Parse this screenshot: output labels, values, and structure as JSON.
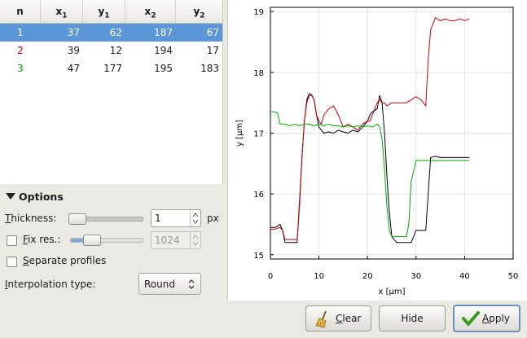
{
  "table": {
    "headers": [
      "n",
      "x",
      "y",
      "x",
      "y"
    ],
    "header_subs": [
      "",
      "1",
      "1",
      "2",
      "2"
    ],
    "rows": [
      {
        "n": "1",
        "x1": "37",
        "y1": "62",
        "x2": "187",
        "y2": "67",
        "color": "#ffffff"
      },
      {
        "n": "2",
        "x1": "39",
        "y1": "12",
        "x2": "194",
        "y2": "17",
        "color": "#cc0000"
      },
      {
        "n": "3",
        "x1": "47",
        "y1": "177",
        "x2": "195",
        "y2": "183",
        "color": "#00a000"
      }
    ]
  },
  "options": {
    "title": "Options",
    "thickness_label": "Thickness:",
    "thickness_value": "1",
    "thickness_unit": "px",
    "thickness_slider_level": 0.0,
    "fixres_label": "Fix res.:",
    "fixres_value": "1024",
    "fixres_checked": false,
    "fixres_slider_level": 0.1,
    "separate_label": "Separate profiles",
    "separate_checked": false,
    "interp_label": "Interpolation type:",
    "interp_value": "Round"
  },
  "buttons": {
    "clear": "Clear",
    "hide": "Hide",
    "apply": "Apply"
  },
  "chart_data": {
    "type": "line",
    "xlabel": "x [µm]",
    "ylabel": "y [µm]",
    "xlim": [
      0,
      50
    ],
    "ylim": [
      14.93,
      19.07
    ],
    "xticks": [
      "0",
      "10",
      "20",
      "30",
      "40",
      "50"
    ],
    "yticks": [
      "15",
      "16",
      "17",
      "18",
      "19"
    ],
    "grid": true,
    "series": [
      {
        "color": "#000000",
        "x": [
          0,
          1,
          2,
          2.5,
          3,
          4,
          5,
          5.5,
          6,
          6.5,
          7,
          7.5,
          8,
          8.5,
          9,
          9.5,
          10,
          10.5,
          11,
          12,
          13,
          14,
          15,
          16,
          17,
          18,
          19,
          20,
          20.5,
          21,
          22,
          22.5,
          23,
          23.5,
          24,
          24.5,
          25,
          26,
          27,
          28,
          29,
          30,
          31,
          32,
          32.5,
          33,
          34,
          35,
          36,
          37,
          38,
          39,
          40,
          41
        ],
        "y": [
          15.45,
          15.45,
          15.5,
          15.4,
          15.2,
          15.2,
          15.2,
          15.2,
          15.9,
          16.6,
          17.2,
          17.55,
          17.65,
          17.63,
          17.55,
          17.3,
          17.1,
          17.05,
          17.0,
          17.02,
          17.0,
          17.05,
          17.02,
          17.0,
          17.05,
          17.02,
          17.1,
          17.2,
          17.3,
          17.35,
          17.4,
          17.62,
          17.5,
          17.0,
          16.3,
          15.7,
          15.3,
          15.2,
          15.2,
          15.2,
          15.2,
          15.4,
          15.4,
          15.4,
          16.0,
          16.6,
          16.62,
          16.6,
          16.6,
          16.6,
          16.6,
          16.6,
          16.6,
          16.6
        ]
      },
      {
        "color": "#cc0000",
        "x": [
          0,
          1,
          2,
          2.5,
          3,
          4,
          5,
          5.5,
          6,
          6.5,
          7,
          7.5,
          8,
          8.5,
          9,
          9.5,
          10,
          10.5,
          11,
          12,
          13,
          14,
          15,
          16,
          17,
          18,
          19,
          20,
          20.5,
          21,
          22,
          22.5,
          23,
          23.5,
          24,
          25,
          26,
          27,
          28,
          29,
          30,
          31,
          31.5,
          32,
          32.5,
          33,
          34,
          35,
          36,
          37,
          38,
          39,
          40,
          41
        ],
        "y": [
          15.42,
          15.42,
          15.45,
          15.4,
          15.25,
          15.25,
          15.25,
          15.25,
          15.8,
          16.6,
          17.2,
          17.5,
          17.62,
          17.62,
          17.55,
          17.3,
          17.2,
          17.15,
          17.3,
          17.4,
          17.45,
          17.3,
          17.1,
          17.15,
          17.1,
          17.05,
          17.15,
          17.2,
          17.2,
          17.3,
          17.5,
          17.55,
          17.5,
          17.5,
          17.45,
          17.5,
          17.5,
          17.5,
          17.5,
          17.55,
          17.6,
          17.55,
          17.5,
          17.45,
          18.2,
          18.7,
          18.9,
          18.85,
          18.88,
          18.85,
          18.85,
          18.88,
          18.85,
          18.88
        ]
      },
      {
        "color": "#00aa00",
        "x": [
          0,
          1,
          1.5,
          2,
          3,
          4,
          5,
          6,
          7,
          8,
          9,
          10,
          11,
          12,
          13,
          14,
          15,
          16,
          17,
          18,
          19,
          20,
          21,
          22,
          22.5,
          23,
          23.5,
          24,
          24.5,
          25,
          26,
          27,
          28,
          28.5,
          29,
          30,
          31,
          32,
          33,
          34,
          35,
          36,
          37,
          38,
          39,
          40,
          41
        ],
        "y": [
          17.35,
          17.35,
          17.32,
          17.15,
          17.15,
          17.12,
          17.15,
          17.12,
          17.15,
          17.15,
          17.12,
          17.15,
          17.12,
          17.15,
          17.12,
          17.12,
          17.1,
          17.12,
          17.1,
          17.12,
          17.1,
          17.12,
          17.1,
          17.15,
          17.1,
          16.9,
          16.4,
          15.8,
          15.4,
          15.3,
          15.3,
          15.3,
          15.3,
          15.5,
          16.2,
          16.55,
          16.55,
          16.55,
          16.55,
          16.55,
          16.55,
          16.55,
          16.55,
          16.55,
          16.55,
          16.55,
          16.55
        ]
      }
    ]
  }
}
